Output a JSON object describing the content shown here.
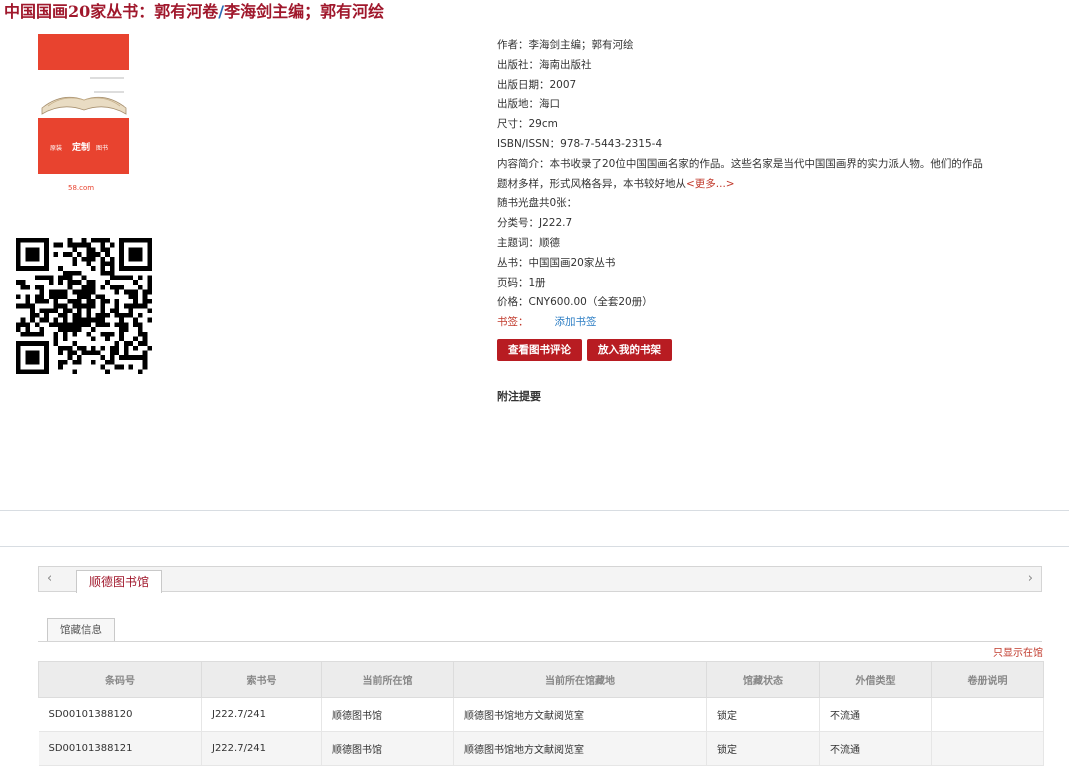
{
  "title": {
    "part1": "中国国画20家丛书：郭有河卷",
    "sep": "/",
    "part2": "李海剑主编；郭有河绘"
  },
  "cover": {
    "tags": [
      "原装",
      "定制",
      "图书"
    ],
    "logo": "58.com"
  },
  "info": {
    "author": "作者：李海剑主编；郭有河绘",
    "publisher": "出版社：海南出版社",
    "date": "出版日期：2007",
    "place": "出版地：海口",
    "size": "尺寸：29cm",
    "isbn": "ISBN/ISSN：978-7-5443-2315-4",
    "intro": "内容简介：本书收录了20位中国国画名家的作品。这些名家是当代中国国画界的实力派人物。他们的作品题材多样，形式风格各异，本书较好地从",
    "more": "<更多...>",
    "disc": "随书光盘共0张：",
    "class": "分类号：J222.7",
    "subject": "主题词：顺德",
    "series": "丛书：中国国画20家丛书",
    "pages": "页码：1册",
    "price": "价格：CNY600.00（全套20册）",
    "bookmark_label": "书签：",
    "bookmark_link": "添加书签"
  },
  "buttons": {
    "review": "查看图书评论",
    "shelf": "放入我的书架"
  },
  "note_title": "附注提要",
  "tabs": {
    "library": "顺德图书馆",
    "holdings": "馆藏信息",
    "arrow_left": "‹",
    "arrow_right": "›"
  },
  "only_in_library": "只显示在馆",
  "table": {
    "headers": [
      "条码号",
      "索书号",
      "当前所在馆",
      "当前所在馆藏地",
      "馆藏状态",
      "外借类型",
      "卷册说明"
    ],
    "rows": [
      [
        "SD00101388120",
        "J222.7/241",
        "顺德图书馆",
        "顺德图书馆地方文献阅览室",
        "锁定",
        "不流通",
        ""
      ],
      [
        "SD00101388121",
        "J222.7/241",
        "顺德图书馆",
        "顺德图书馆地方文献阅览室",
        "锁定",
        "不流通",
        ""
      ]
    ]
  },
  "colors": {
    "brand_red": "#a0182c",
    "button_red": "#b81c22",
    "link_blue": "#2d7ec4"
  }
}
